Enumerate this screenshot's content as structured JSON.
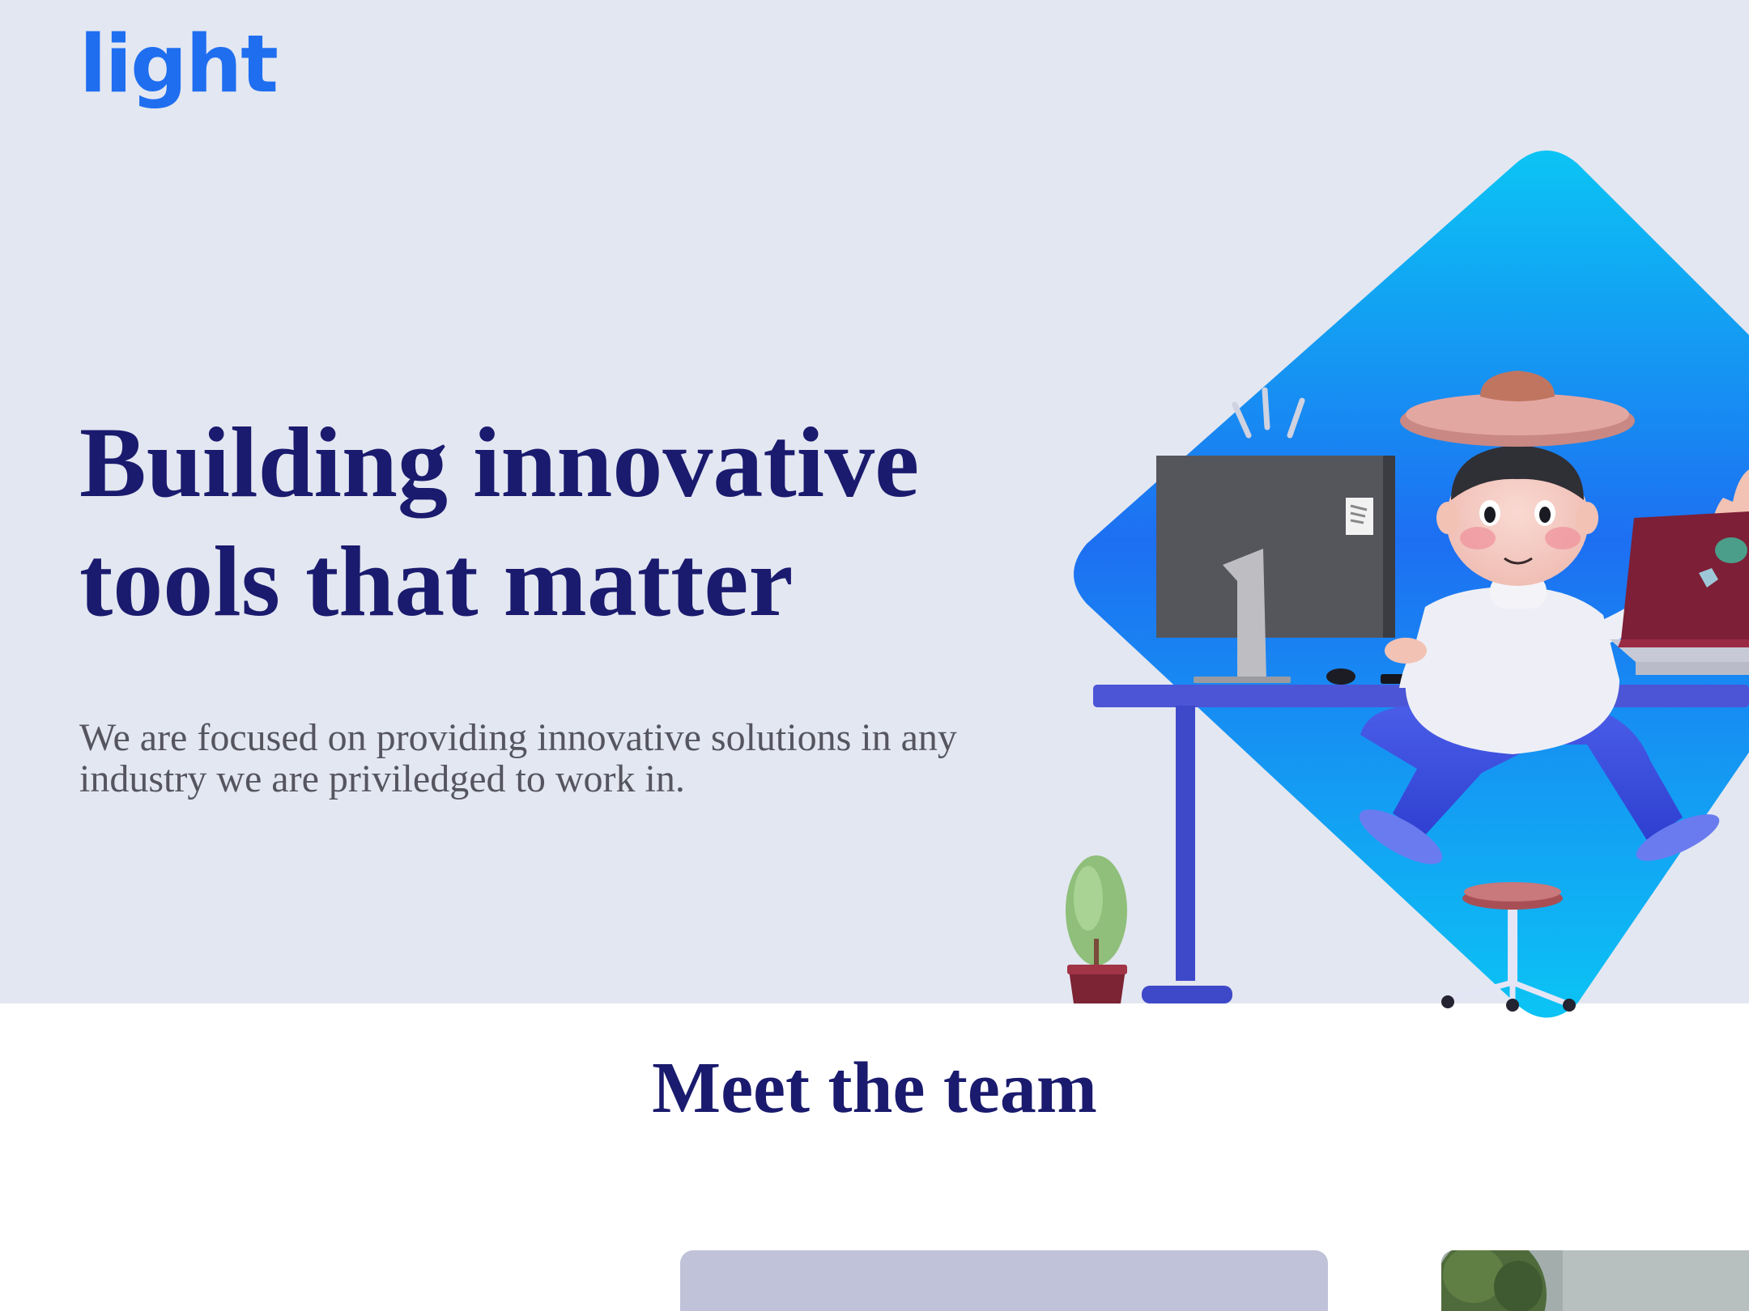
{
  "brand": {
    "logo_text": "light",
    "accent_color": "#1f6ef0",
    "heading_color": "#1a1a6e"
  },
  "hero": {
    "headline_line1": "Building innovative",
    "headline_line2": "tools that matter",
    "subtext_line1": "We are focused on providing innovative solutions in any",
    "subtext_line2": "industry we are priviledged to work in.",
    "background_color": "#e3e7f1",
    "illustration_icon": "person-at-desk-illustration"
  },
  "team": {
    "title": "Meet the team"
  }
}
